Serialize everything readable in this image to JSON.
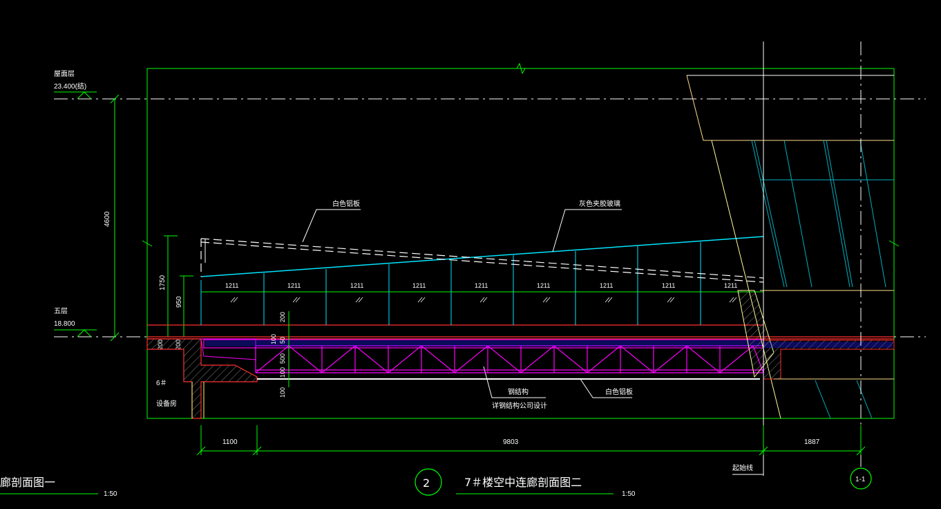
{
  "drawing": {
    "title": "7＃楼空中连廊剖面图二",
    "title_scale": "1:50",
    "detail_number": "2",
    "prev_title_fragment": "廊剖面图一",
    "prev_scale": "1:50",
    "axis_label": "1-1"
  },
  "levels": {
    "roof_name": "屋面层",
    "roof_elev": "23.400(结)",
    "fifth_name": "五层",
    "fifth_elev": "18.800"
  },
  "dimensions": {
    "storey_height": "4600",
    "rail_height": "1750",
    "glass_height": "950",
    "slab_200": "200",
    "slab_left_200": "200",
    "slab_left_200b": "200",
    "truss_100a": "100",
    "truss_50": "50",
    "truss_500": "500",
    "truss_100b": "100",
    "truss_100c": "100",
    "panel_width": "1211",
    "span_left": "1100",
    "span_main": "9803",
    "span_right": "1887"
  },
  "labels": {
    "white_aluminium": "白色铝板",
    "grey_glass": "灰色夹胶玻璃",
    "steel_structure": "钢结构",
    "steel_note": "详钢结构公司设计",
    "white_aluminium_bottom": "白色铝板",
    "room_no": "6＃",
    "room_name": "设备房",
    "start_line": "起始线"
  },
  "colors": {
    "background": "#000000",
    "frame": "#00ff00",
    "truss": "#ff00ff",
    "glass": "#00e5ff",
    "slab": "#ff3030",
    "text": "#ffffff",
    "wall": "#ffff66",
    "hatch_blue": "#2020ff"
  }
}
